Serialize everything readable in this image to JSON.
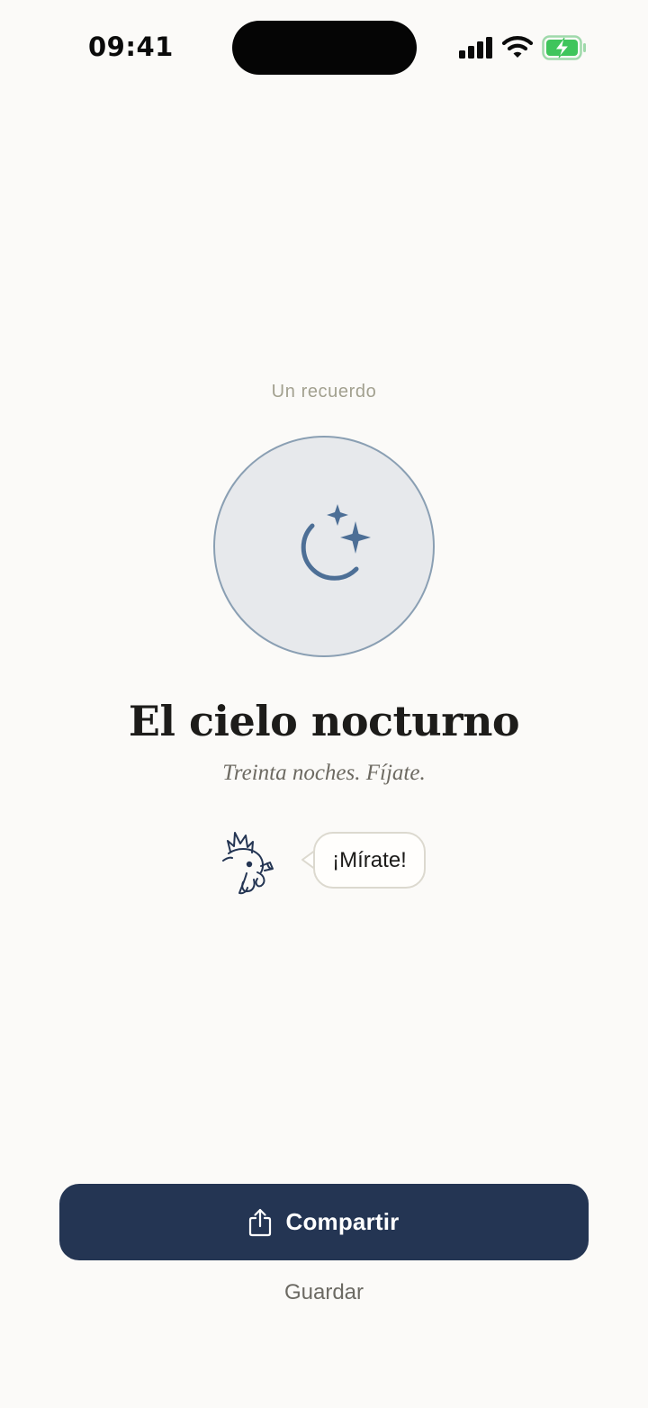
{
  "status_bar": {
    "time": "09:41",
    "battery_color": "#3fc55c"
  },
  "screen": {
    "eyebrow": "Un recuerdo",
    "icon": "moon-stars-icon",
    "title": "El cielo nocturno",
    "subtitle": "Treinta noches. Fíjate.",
    "mascot": "rooster-icon",
    "speech": "¡Mírate!"
  },
  "actions": {
    "share_label": "Compartir",
    "share_icon": "share-icon",
    "save_label": "Guardar"
  },
  "colors": {
    "background": "#fbfaf8",
    "primary": "#243553",
    "accent_icon": "#4d6f96",
    "medallion_fill": "#e7e9ec",
    "medallion_border": "#8a9fb3"
  }
}
